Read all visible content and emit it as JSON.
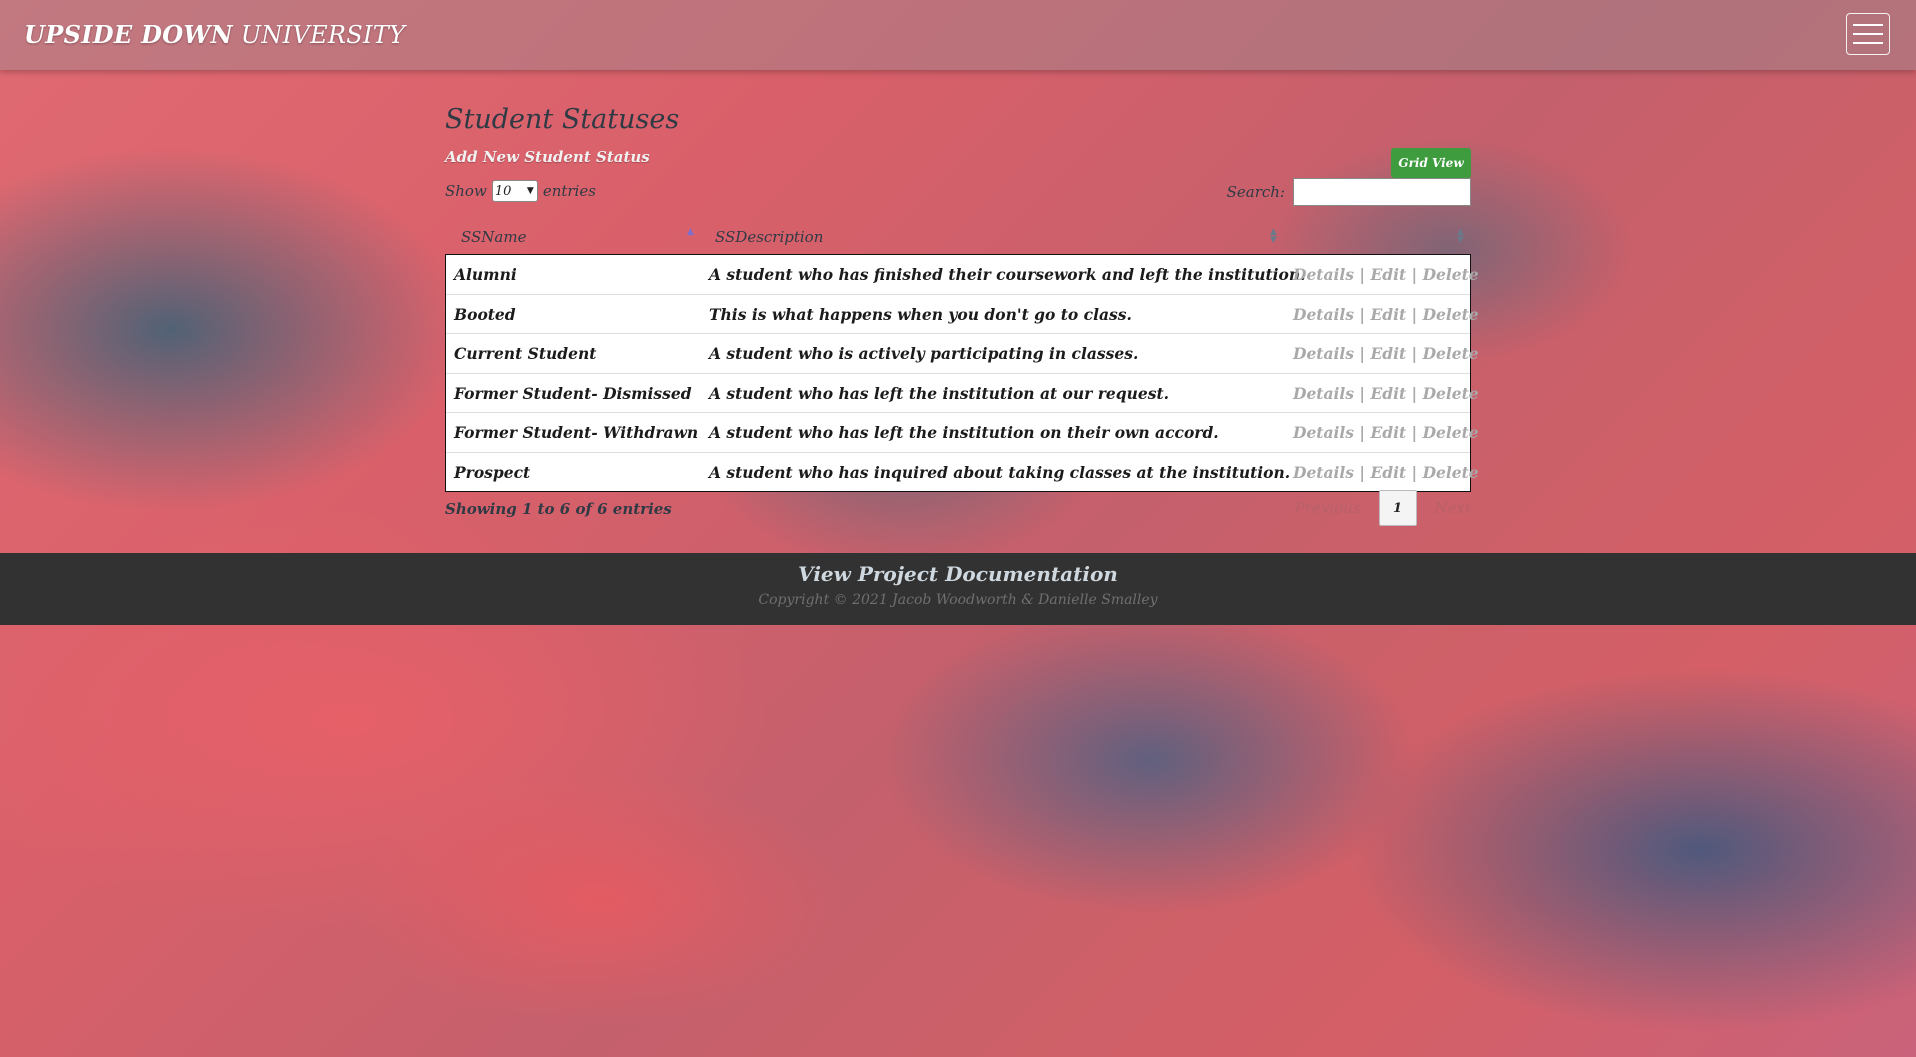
{
  "brand": {
    "bold": "UPSIDE DOWN",
    "rest": " UNIVERSITY"
  },
  "page": {
    "title": "Student Statuses",
    "add_link": "Add New Student Status",
    "grid_button": "Grid View",
    "show_label": "Show",
    "entries_value": "10",
    "entries_label": "entries",
    "search_label": "Search:",
    "search_value": ""
  },
  "table": {
    "headers": [
      "SSName",
      "SSDescription"
    ],
    "rows": [
      {
        "name": "Alumni",
        "desc": "A student who has finished their coursework and left the institution.",
        "details": "Details",
        "edit": "Edit",
        "delete": "Delete"
      },
      {
        "name": "Booted",
        "desc": "This is what happens when you don't go to class.",
        "details": "Details",
        "edit": "Edit",
        "delete": "Delete"
      },
      {
        "name": "Current Student",
        "desc": "A student who is actively participating in classes.",
        "details": "Details",
        "edit": "Edit",
        "delete": "Delete"
      },
      {
        "name": "Former Student- Dismissed",
        "desc": "A student who has left the institution at our request.",
        "details": "Details",
        "edit": "Edit",
        "delete": "Delete"
      },
      {
        "name": "Former Student- Withdrawn",
        "desc": "A student who has left the institution on their own accord.",
        "details": "Details",
        "edit": "Edit",
        "delete": "Delete"
      },
      {
        "name": "Prospect",
        "desc": "A student who has inquired about taking classes at the institution.",
        "details": "Details",
        "edit": "Edit",
        "delete": "Delete"
      }
    ],
    "info": "Showing 1 to 6 of 6 entries",
    "previous": "Previous",
    "current_page": "1",
    "next": "Next"
  },
  "footer": {
    "doc_link": "View Project Documentation",
    "copyright": "Copyright © 2021 Jacob Woodworth & Danielle Smalley"
  }
}
